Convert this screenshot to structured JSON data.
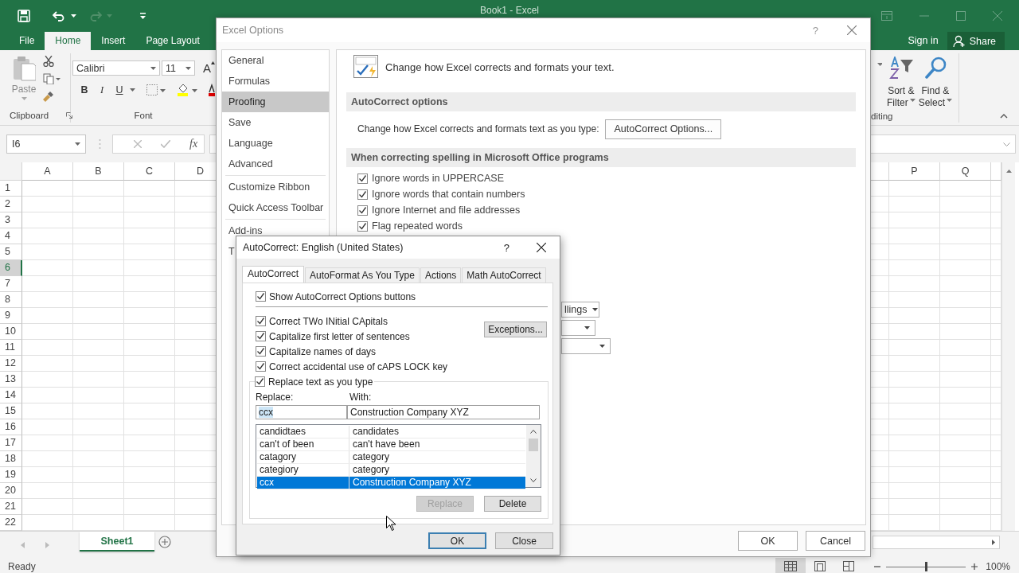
{
  "excel": {
    "title": "Book1 - Excel",
    "ribbon_tabs": [
      {
        "label": "File",
        "selected": false
      },
      {
        "label": "Home",
        "selected": true
      },
      {
        "label": "Insert",
        "selected": false
      },
      {
        "label": "Page Layout",
        "selected": false
      }
    ],
    "sign_in": "Sign in",
    "share": "Share",
    "clipboard": {
      "paste": "Paste",
      "label": "Clipboard"
    },
    "font": {
      "name": "Calibri",
      "size": "11",
      "grow": "A",
      "bold": "B",
      "italic": "I",
      "underline": "U",
      "label": "Font"
    },
    "editing": {
      "sort": "Sort &",
      "filter": "Filter",
      "find": "Find &",
      "select": "Select",
      "label": "diting"
    },
    "name_box": "I6",
    "function_label": "fx",
    "columns_left": [
      "A",
      "B",
      "C",
      "D"
    ],
    "columns_right": [
      "P",
      "Q"
    ],
    "rows": [
      {
        "label": "1",
        "selected": false
      },
      {
        "label": "2",
        "selected": false
      },
      {
        "label": "3",
        "selected": false
      },
      {
        "label": "4",
        "selected": false
      },
      {
        "label": "5",
        "selected": false
      },
      {
        "label": "6",
        "selected": true
      },
      {
        "label": "7",
        "selected": false
      },
      {
        "label": "8",
        "selected": false
      },
      {
        "label": "9",
        "selected": false
      },
      {
        "label": "10",
        "selected": false
      },
      {
        "label": "11",
        "selected": false
      },
      {
        "label": "12",
        "selected": false
      },
      {
        "label": "13",
        "selected": false
      },
      {
        "label": "14",
        "selected": false
      },
      {
        "label": "15",
        "selected": false
      },
      {
        "label": "16",
        "selected": false
      },
      {
        "label": "17",
        "selected": false
      },
      {
        "label": "18",
        "selected": false
      },
      {
        "label": "19",
        "selected": false
      },
      {
        "label": "20",
        "selected": false
      },
      {
        "label": "21",
        "selected": false
      },
      {
        "label": "22",
        "selected": false
      }
    ],
    "sheet_tabs": [
      {
        "label": "Sheet1",
        "selected": true
      }
    ],
    "status": "Ready",
    "zoom": {
      "level": 0.5,
      "reading": "100%"
    }
  },
  "options": {
    "title": "Excel Options",
    "help": "?",
    "nav_groups": [
      [
        {
          "label": "General",
          "selected": false
        },
        {
          "label": "Formulas",
          "selected": false
        },
        {
          "label": "Proofing",
          "selected": true
        },
        {
          "label": "Save",
          "selected": false
        },
        {
          "label": "Language",
          "selected": false
        },
        {
          "label": "Advanced",
          "selected": false
        }
      ],
      [
        {
          "label": "Customize Ribbon",
          "selected": false
        },
        {
          "label": "Quick Access Toolbar",
          "selected": false
        }
      ],
      [
        {
          "label": "Add-ins",
          "selected": false
        },
        {
          "label": "T",
          "selected": false
        }
      ]
    ],
    "header": "Change how Excel corrects and formats your text.",
    "sections": [
      {
        "title": "AutoCorrect options",
        "items": [
          {
            "kind": "button_row",
            "text": "Change how Excel corrects and formats text as you type:",
            "button": "AutoCorrect Options..."
          }
        ]
      },
      {
        "title": "When correcting spelling in Microsoft Office programs",
        "items": [
          {
            "kind": "checkbox",
            "label": "Ignore words in UPPERCASE",
            "checked": true
          },
          {
            "kind": "checkbox",
            "label": "Ignore words that contain numbers",
            "checked": true
          },
          {
            "kind": "checkbox",
            "label": "Ignore Internet and file addresses",
            "checked": true
          },
          {
            "kind": "checkbox",
            "label": "Flag repeated words",
            "checked": true
          }
        ]
      }
    ],
    "dropdowns": [
      {
        "kind": "text",
        "value": "llings"
      },
      {
        "kind": "empty"
      },
      {
        "kind": "empty"
      }
    ],
    "buttons": [
      "OK",
      "Cancel"
    ]
  },
  "autocorrect": {
    "title": "AutoCorrect: English (United States)",
    "help": "?",
    "tabs": [
      {
        "label": "AutoCorrect",
        "selected": true
      },
      {
        "label": "AutoFormat As You Type",
        "selected": false
      },
      {
        "label": "Actions",
        "selected": false
      },
      {
        "label": "Math AutoCorrect",
        "selected": false
      }
    ],
    "show_buttons": {
      "label": "Show AutoCorrect Options buttons",
      "checked": true
    },
    "options": [
      {
        "label": "Correct TWo INitial CApitals",
        "checked": true
      },
      {
        "label": "Capitalize first letter of sentences",
        "checked": true
      },
      {
        "label": "Capitalize names of days",
        "checked": true
      },
      {
        "label": "Correct accidental use of cAPS LOCK key",
        "checked": true
      }
    ],
    "exceptions": "Exceptions...",
    "replace_as_type": {
      "label": "Replace text as you type",
      "checked": true
    },
    "replace_label": "Replace:",
    "with_label": "With:",
    "replace_value": "ccx",
    "with_value": "Construction Company XYZ",
    "entries": [
      {
        "replace": "candidtaes",
        "with": "candidates",
        "selected": false
      },
      {
        "replace": "can't of been",
        "with": "can't have been",
        "selected": false
      },
      {
        "replace": "catagory",
        "with": "category",
        "selected": false
      },
      {
        "replace": "categiory",
        "with": "category",
        "selected": false
      },
      {
        "replace": "ccx",
        "with": "Construction Company XYZ",
        "selected": true
      }
    ],
    "replace_button": {
      "label": "Replace",
      "disabled": true
    },
    "delete_button": {
      "label": "Delete",
      "disabled": false
    },
    "ok": "OK",
    "close": "Close"
  }
}
